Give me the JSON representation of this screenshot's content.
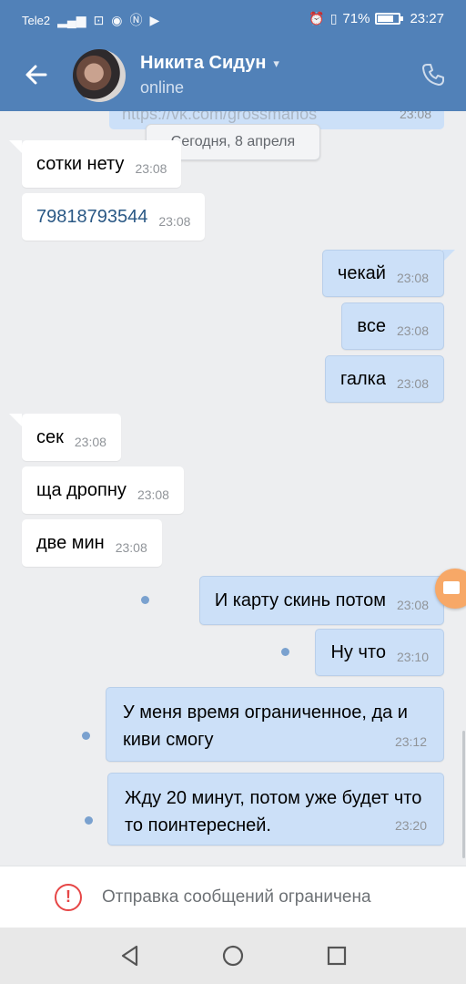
{
  "status_bar": {
    "carrier": "Tele2",
    "battery": "71%",
    "time": "23:27"
  },
  "header": {
    "contact_name": "Никита Сидун",
    "status": "online"
  },
  "chat": {
    "partial_top_text": "https://vk.com/grossmanos",
    "partial_top_time": "23:08",
    "date_separator": "Сегодня, 8 апреля",
    "messages": [
      {
        "dir": "in",
        "text": "сотки нету",
        "time": "23:08"
      },
      {
        "dir": "in",
        "text": "79818793544",
        "time": "23:08",
        "link": true
      },
      {
        "dir": "out",
        "text": "чекай",
        "time": "23:08"
      },
      {
        "dir": "out",
        "text": "все",
        "time": "23:08"
      },
      {
        "dir": "out",
        "text": "галка",
        "time": "23:08"
      },
      {
        "dir": "in",
        "text": "сек",
        "time": "23:08"
      },
      {
        "dir": "in",
        "text": "ща дропну",
        "time": "23:08"
      },
      {
        "dir": "in",
        "text": "две мин",
        "time": "23:08"
      },
      {
        "dir": "out",
        "text": "И карту скинь потом",
        "time": "23:08",
        "unread": true
      },
      {
        "dir": "out",
        "text": "Ну что",
        "time": "23:10",
        "unread": true
      },
      {
        "dir": "out",
        "text": "У меня время ограниченное, да и киви смогу",
        "time": "23:12",
        "unread": true
      },
      {
        "dir": "out",
        "text": "Жду 20 минут, потом уже будет что то поинтересней.",
        "time": "23:20",
        "unread": true
      }
    ]
  },
  "restriction": {
    "icon": "exclamation-circle-icon",
    "text": "Отправка сообщений ограничена",
    "color": "#e64646"
  },
  "colors": {
    "header": "#5181b8",
    "outgoing_bubble": "#cce0f8",
    "incoming_bubble": "#ffffff",
    "background": "#edeef0"
  }
}
